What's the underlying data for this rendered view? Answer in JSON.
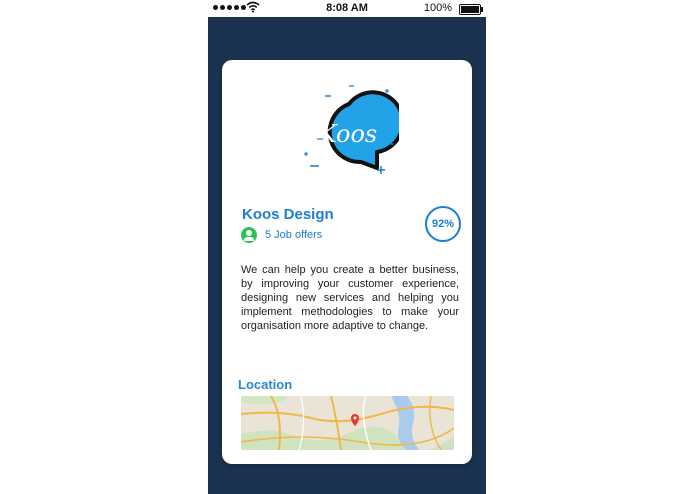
{
  "status_bar": {
    "time": "8:08 AM",
    "battery": "100%"
  },
  "card": {
    "logo_text": "Koos",
    "company_name": "Koos Design",
    "job_offers": "5 Job offers",
    "match_percent": "92%",
    "description": "We can help you create a better business, by improving your customer experience, designing new services and helping you implement methodologies to make your organisation more adaptive to change.",
    "location_label": "Location"
  },
  "colors": {
    "brand_blue": "#1b7ed3",
    "logo_blue": "#22a3e8",
    "screen_background": "#1b3350",
    "accent_green": "#2fbf5b",
    "map_pin": "#e53935"
  }
}
